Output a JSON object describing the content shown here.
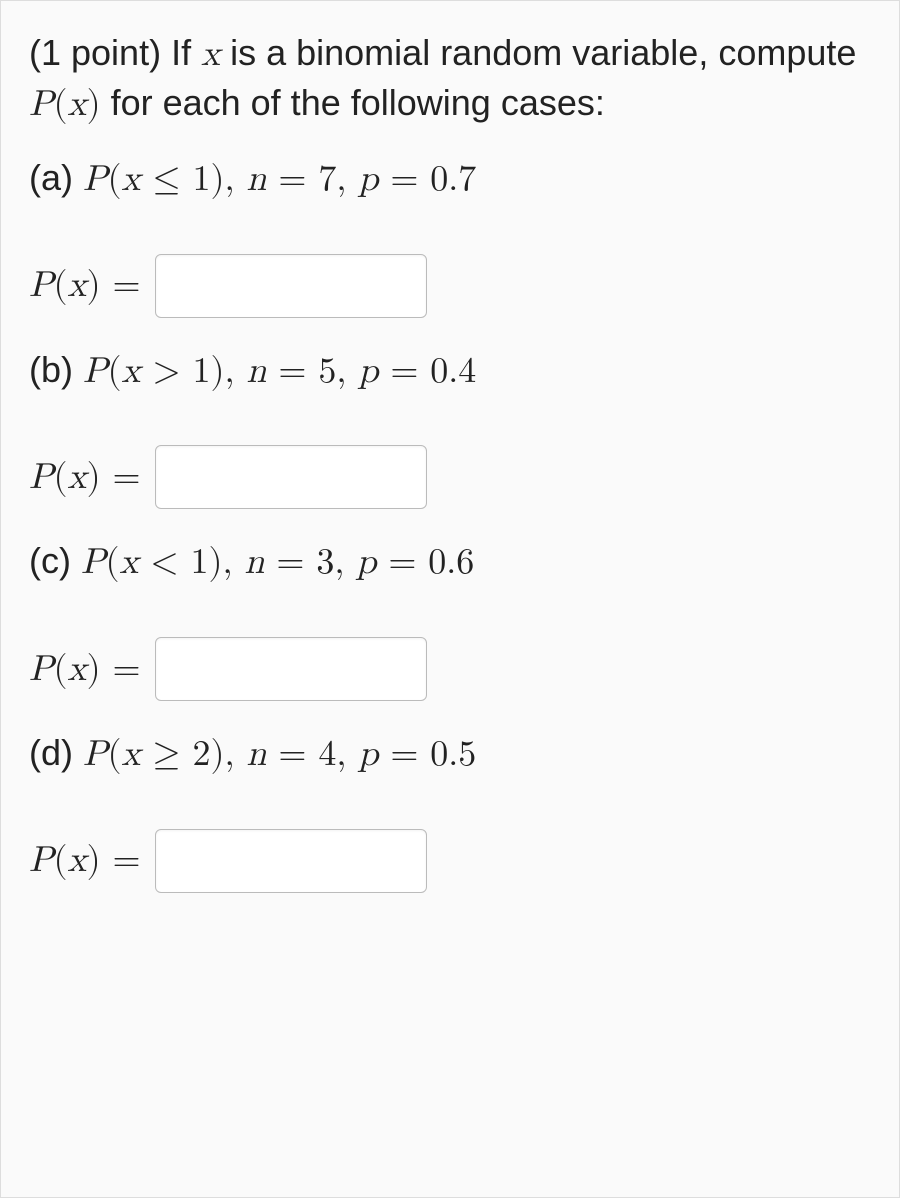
{
  "intro": {
    "points_prefix": "(1 point) If ",
    "var": "x",
    "mid": " is a binomial random variable, compute ",
    "Px": "P(x)",
    "tail": " for each of the following cases:"
  },
  "parts": {
    "a": {
      "label": "(a)  ",
      "expr_pre": "P(x ≤ 1), n = 7, p = 0.7",
      "value": ""
    },
    "b": {
      "label": "(b)  ",
      "expr_pre": "P(x > 1), n = 5, p = 0.4",
      "value": ""
    },
    "c": {
      "label": "(c)  ",
      "expr_pre": "P(x < 1), n = 3, p = 0.6",
      "value": ""
    },
    "d": {
      "label": "(d)  ",
      "expr_pre": "P(x ≥ 2), n = 4, p = 0.5",
      "value": ""
    }
  },
  "answer_label": "P(x) ="
}
